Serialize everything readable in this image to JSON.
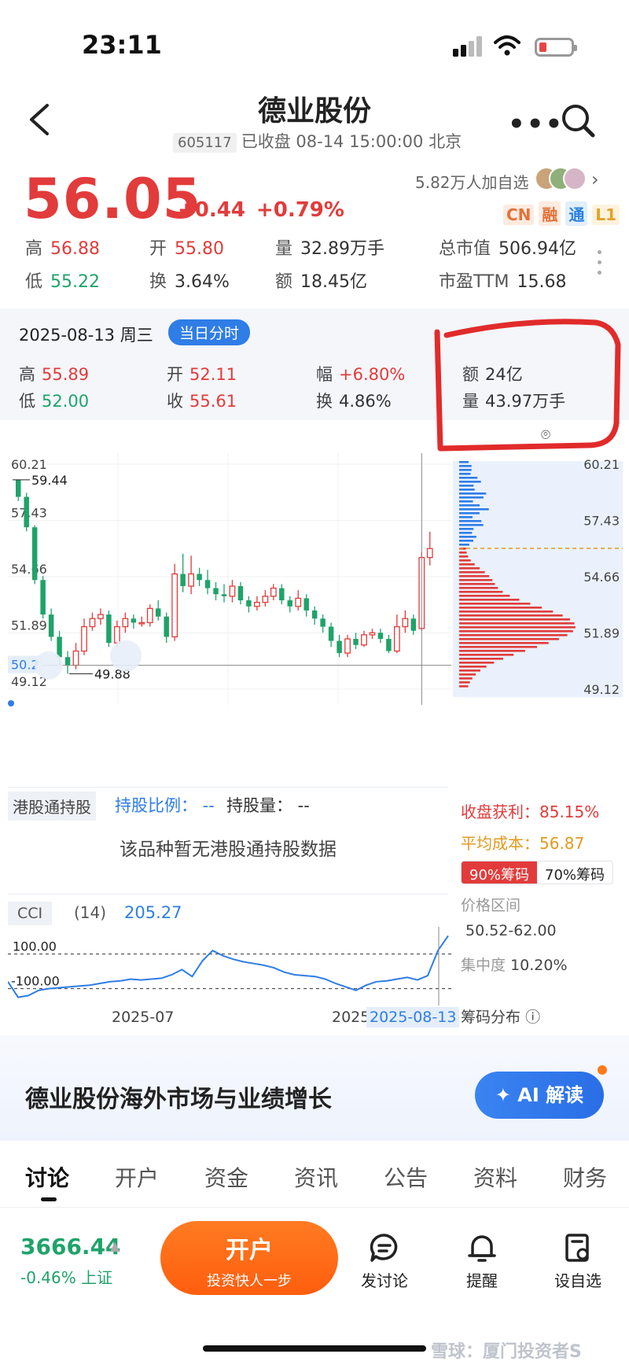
{
  "status": {
    "time": "23:11"
  },
  "header": {
    "title": "德业股份",
    "code": "605117",
    "subtitle": "已收盘 08-14 15:00:00 北京"
  },
  "quote": {
    "price": "56.05",
    "change": "+0.44",
    "change_pct": "+0.79%",
    "followers": "5.82万人加自选",
    "tags": [
      "CN",
      "融",
      "通",
      "L1"
    ],
    "metrics": {
      "high_label": "高",
      "high": "56.88",
      "open_label": "开",
      "open": "55.80",
      "vol_label": "量",
      "vol": "32.89万手",
      "mcap_label": "总市值",
      "mcap": "506.94亿",
      "low_label": "低",
      "low": "55.22",
      "turn_label": "换",
      "turn": "3.64%",
      "amt_label": "额",
      "amt": "18.45亿",
      "pe_label": "市盈TTM",
      "pe": "15.68"
    }
  },
  "panel": {
    "date": "2025-08-13 周三",
    "badge": "当日分时",
    "high_label": "高",
    "high": "55.89",
    "open_label": "开",
    "open": "52.11",
    "amp_label": "幅",
    "amp": "+6.80%",
    "amt_label": "额",
    "amt": "24亿",
    "low_label": "低",
    "low": "52.00",
    "close_label": "收",
    "close": "55.61",
    "turn_label": "换",
    "turn": "4.86%",
    "vol_label": "量",
    "vol": "43.97万手"
  },
  "chart": {
    "y_labels": [
      "60.21",
      "57.43",
      "54.66",
      "51.89",
      "49.12"
    ],
    "max_label": "59.44",
    "min_label": "49.88",
    "current_label": "50.2",
    "colors": {
      "up": "#e23b3b",
      "down": "#1fa36a"
    }
  },
  "chart_data": {
    "type": "candlestick",
    "ylim": [
      49.12,
      60.21
    ],
    "candles": [
      [
        59.44,
        58.6,
        59.44,
        58.4
      ],
      [
        58.6,
        57.1,
        58.8,
        56.9
      ],
      [
        57.1,
        54.5,
        57.2,
        54.3
      ],
      [
        54.5,
        52.8,
        54.7,
        52.6
      ],
      [
        52.8,
        51.7,
        53.1,
        51.5
      ],
      [
        51.7,
        50.7,
        52.0,
        50.3
      ],
      [
        50.7,
        50.3,
        51.0,
        49.88
      ],
      [
        50.3,
        51.0,
        51.4,
        50.1
      ],
      [
        51.0,
        52.2,
        52.6,
        50.8
      ],
      [
        52.2,
        52.6,
        52.9,
        52.0
      ],
      [
        52.6,
        52.8,
        53.1,
        52.3
      ],
      [
        52.8,
        51.4,
        53.0,
        51.2
      ],
      [
        51.4,
        52.2,
        52.5,
        51.2
      ],
      [
        52.2,
        52.6,
        52.9,
        51.9
      ],
      [
        52.6,
        52.4,
        52.8,
        52.1
      ],
      [
        52.4,
        52.4,
        52.7,
        52.2
      ],
      [
        52.4,
        53.1,
        53.3,
        52.2
      ],
      [
        53.1,
        52.7,
        53.5,
        52.5
      ],
      [
        52.7,
        51.7,
        52.9,
        51.4
      ],
      [
        51.7,
        54.8,
        55.3,
        51.5
      ],
      [
        54.8,
        54.2,
        55.8,
        53.9
      ],
      [
        54.2,
        54.8,
        55.7,
        53.8
      ],
      [
        54.8,
        54.5,
        55.1,
        54.2
      ],
      [
        54.5,
        54.1,
        55.0,
        53.8
      ],
      [
        54.1,
        53.8,
        54.4,
        53.5
      ],
      [
        53.8,
        53.7,
        54.3,
        53.4
      ],
      [
        53.7,
        54.2,
        54.5,
        53.4
      ],
      [
        54.2,
        53.5,
        54.4,
        53.3
      ],
      [
        53.5,
        53.2,
        53.7,
        52.9
      ],
      [
        53.2,
        53.4,
        53.7,
        53.0
      ],
      [
        53.4,
        53.7,
        54.0,
        53.2
      ],
      [
        53.7,
        54.1,
        54.3,
        53.5
      ],
      [
        54.1,
        53.5,
        54.3,
        53.3
      ],
      [
        53.5,
        53.2,
        53.7,
        52.9
      ],
      [
        53.2,
        53.6,
        54.0,
        53.0
      ],
      [
        53.6,
        53.0,
        53.8,
        52.7
      ],
      [
        53.0,
        52.6,
        53.2,
        52.3
      ],
      [
        52.6,
        52.2,
        52.8,
        51.9
      ],
      [
        52.2,
        51.5,
        52.4,
        51.2
      ],
      [
        51.5,
        50.9,
        51.8,
        50.7
      ],
      [
        50.9,
        51.6,
        51.8,
        50.7
      ],
      [
        51.6,
        51.3,
        51.9,
        51.1
      ],
      [
        51.3,
        51.8,
        52.0,
        51.2
      ],
      [
        51.8,
        51.9,
        52.1,
        51.6
      ],
      [
        51.9,
        51.6,
        52.1,
        51.4
      ],
      [
        51.6,
        51.0,
        51.8,
        50.9
      ],
      [
        51.0,
        52.2,
        52.8,
        50.9
      ],
      [
        52.2,
        52.6,
        53.0,
        51.9
      ],
      [
        52.6,
        52.0,
        52.8,
        51.8
      ],
      [
        52.11,
        55.61,
        55.89,
        52.0
      ],
      [
        55.61,
        56.05,
        56.88,
        55.22
      ]
    ],
    "last_price": 56.05
  },
  "hk": {
    "title": "港股通持股",
    "ratio": "持股比例： --",
    "qty": "持股量： --",
    "empty": "该品种暂无港股通持股数据"
  },
  "cci": {
    "label": "CCI",
    "param": "(14)",
    "value": "205.27",
    "level_hi": "100.00",
    "level_lo": "-100.00",
    "x_label1": "2025-07",
    "x_label2": "2025",
    "x_active": "2025-08-13",
    "values": [
      -60,
      -150,
      -140,
      -110,
      -100,
      -95,
      -90,
      -85,
      -80,
      -70,
      -60,
      -55,
      -45,
      -50,
      -45,
      -40,
      -20,
      10,
      -30,
      60,
      120,
      90,
      70,
      55,
      45,
      35,
      20,
      -5,
      -20,
      -25,
      -30,
      -45,
      -70,
      -90,
      -110,
      -80,
      -60,
      -55,
      -45,
      -35,
      -50,
      -25,
      120,
      205
    ]
  },
  "side": {
    "profit_label": "收盘获利：",
    "profit": "85.15%",
    "cost_label": "平均成本：",
    "cost": "56.87",
    "tab_on": "90%筹码",
    "tab_off": "70%筹码",
    "range_label": "价格区间",
    "range": "50.52-62.00",
    "conc_label": "集中度",
    "conc": "10.20%",
    "dist_label": "筹码分布"
  },
  "banner": {
    "text": "德业股份海外市场与业绩增长",
    "ai_label": "AI 解读"
  },
  "tabs": [
    "讨论",
    "开户",
    "资金",
    "资讯",
    "公告",
    "资料",
    "财务"
  ],
  "bottom": {
    "index_value": "3666.44",
    "index_change": "-0.46%",
    "index_name": "上证",
    "open_label": "开户",
    "open_sub": "投资快人一步",
    "discuss": "发讨论",
    "remind": "提醒",
    "watchlist": "设自选"
  },
  "watermark": "雪球：厦门投资者S"
}
